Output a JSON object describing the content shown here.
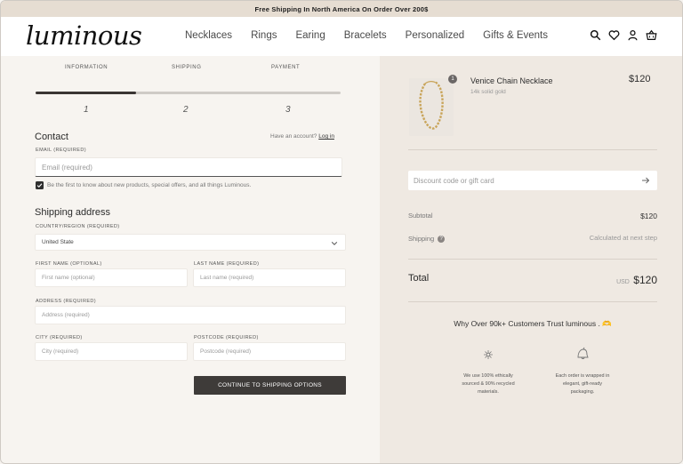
{
  "announcement": "Free Shipping In North America On Order Over 200$",
  "brand": {
    "logo_text": "luminous"
  },
  "nav": {
    "items": [
      "Necklaces",
      "Rings",
      "Earing",
      "Bracelets",
      "Personalized",
      "Gifts & Events"
    ]
  },
  "header_icons": [
    "search-icon",
    "heart-icon",
    "user-icon",
    "basket-icon"
  ],
  "checkout": {
    "steps": [
      {
        "label": "INFORMATION",
        "number": "1"
      },
      {
        "label": "SHIPPING",
        "number": "2"
      },
      {
        "label": "PAYMENT",
        "number": "3"
      }
    ],
    "progress_fraction": 0.33,
    "contact": {
      "title": "Contact",
      "account_prompt": "Have an account?",
      "login_link": "Log in",
      "email_label": "EMAIL (REQUIRED)",
      "email_placeholder": "Email (required)",
      "newsletter_text": "Be the first to know about new products, special offers, and all things Luminous.",
      "newsletter_checked": true
    },
    "shipping": {
      "title": "Shipping address",
      "country_label": "COUNTRY/REGION (REQUIRED)",
      "country_value": "United State",
      "first_name_label": "FIRST NAME (OPTIONAL)",
      "first_name_placeholder": "First name (optional)",
      "last_name_label": "LAST NAME (REQUIRED)",
      "last_name_placeholder": "Last name (required)",
      "address_label": "ADDRESS (REQUIRED)",
      "address_placeholder": "Address (required)",
      "city_label": "CITY (REQUIRED)",
      "city_placeholder": "City (required)",
      "postcode_label": "POSTCODE (REQUIRED)",
      "postcode_placeholder": "Postcode (required)"
    },
    "continue_button": "CONTINUE TO SHIPPING OPTIONS"
  },
  "summary": {
    "product": {
      "name": "Venice Chain Necklace",
      "variant": "14k solid gold",
      "price": "$120",
      "quantity": "1"
    },
    "discount_placeholder": "Discount code or gift card",
    "subtotal_label": "Subtotal",
    "subtotal_value": "$120",
    "shipping_label": "Shipping",
    "shipping_value": "Calculated at next step",
    "total_label": "Total",
    "total_currency": "USD",
    "total_value": "$120",
    "trust_title": "Why Over 90k+ Customers Trust luminous . 🫶",
    "trust_items": [
      {
        "icon": "sparkle-icon",
        "text": "We use 100% ethically sourced & 90% recycled materials."
      },
      {
        "icon": "gift-bell-icon",
        "text": "Each order is wrapped in elegant, gift-ready packaging."
      }
    ]
  },
  "colors": {
    "announcement_bg": "#e6ddd2",
    "left_bg": "#f7f4f0",
    "right_bg": "#efe9e2",
    "button_bg": "#3e3b39"
  }
}
